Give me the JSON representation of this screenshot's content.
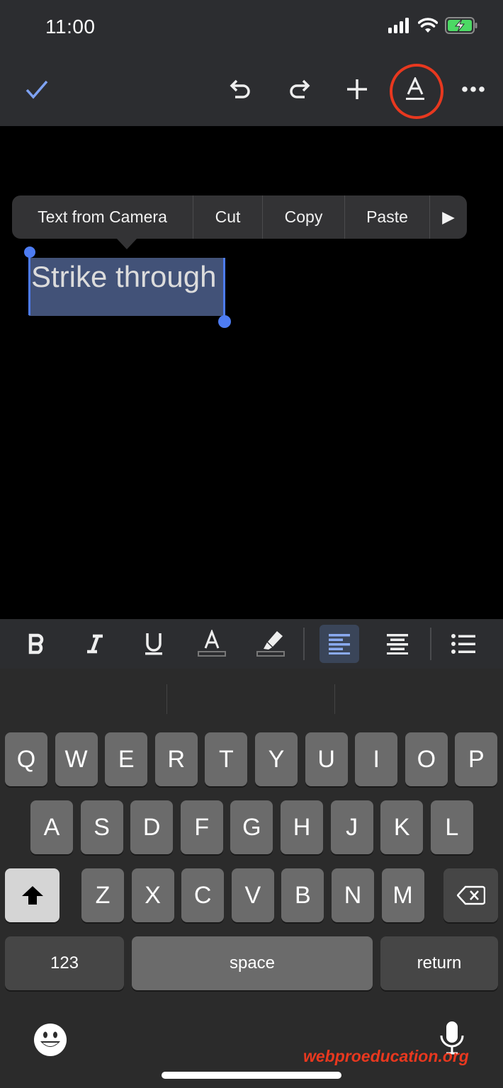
{
  "status_bar": {
    "time": "11:00",
    "icons": [
      "cellular-signal-icon",
      "wifi-icon",
      "battery-charging-icon"
    ],
    "battery_color": "#4cd964"
  },
  "toolbar": {
    "icons": [
      "check-icon",
      "undo-icon",
      "redo-icon",
      "add-icon",
      "text-format-icon",
      "more-icon"
    ],
    "check_color": "#7ea2f2",
    "highlight_ring_color": "#e8381f"
  },
  "document": {
    "selected_text": "Strike through",
    "selection_color": "#425278",
    "handle_color": "#4d7cf3"
  },
  "context_menu": {
    "items": [
      {
        "label": "Text from Camera"
      },
      {
        "label": "Cut"
      },
      {
        "label": "Copy"
      },
      {
        "label": "Paste"
      },
      {
        "label": "▶"
      }
    ]
  },
  "format_bar": {
    "items": [
      {
        "icon": "bold-icon",
        "glyph": "B"
      },
      {
        "icon": "italic-icon",
        "glyph": "I"
      },
      {
        "icon": "underline-icon",
        "glyph": "U"
      },
      {
        "icon": "text-color-icon",
        "glyph": "A"
      },
      {
        "icon": "highlight-icon"
      },
      {
        "icon": "align-left-icon",
        "active": true
      },
      {
        "icon": "align-center-icon"
      },
      {
        "icon": "bulleted-list-icon"
      }
    ],
    "active_color": "#8aaaf0"
  },
  "keyboard": {
    "row1": [
      "Q",
      "W",
      "E",
      "R",
      "T",
      "Y",
      "U",
      "I",
      "O",
      "P"
    ],
    "row2": [
      "A",
      "S",
      "D",
      "F",
      "G",
      "H",
      "J",
      "K",
      "L"
    ],
    "row3": [
      "Z",
      "X",
      "C",
      "V",
      "B",
      "N",
      "M"
    ],
    "numbers_label": "123",
    "space_label": "space",
    "return_label": "return",
    "bottom_icons": [
      "emoji-icon",
      "microphone-icon"
    ]
  },
  "watermark": "webproeducation.org"
}
